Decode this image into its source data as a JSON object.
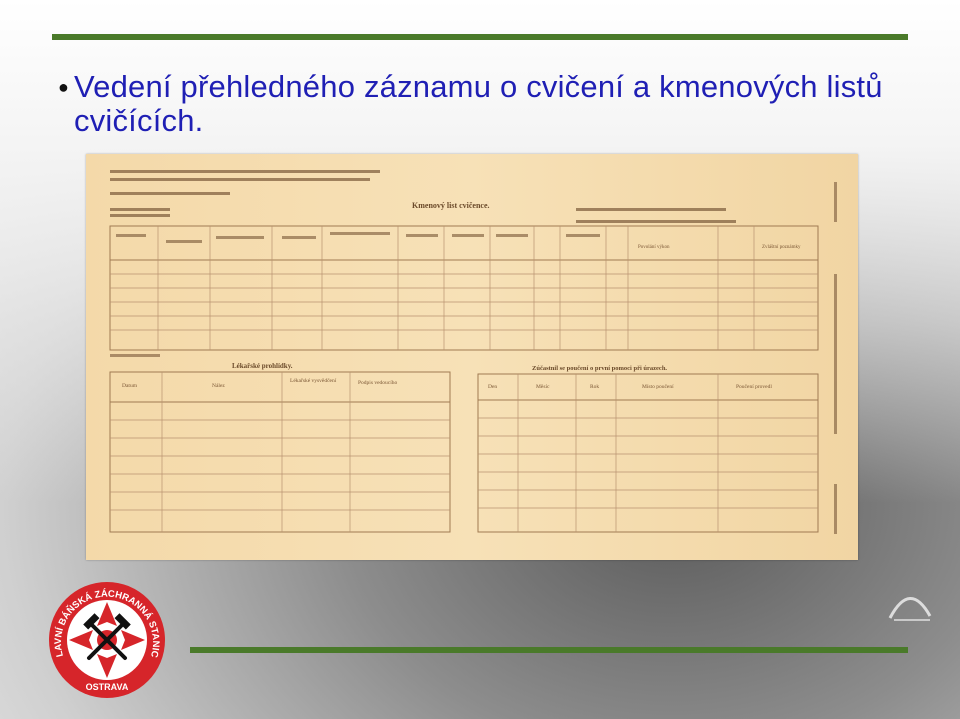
{
  "slide": {
    "title_line1": "Vedení přehledného záznamu o cvičení a  kmenových listů",
    "title_line2": "cvičících.",
    "colors": {
      "title": "#1f1fb4",
      "bars": "#4a7a2a",
      "logo_red": "#d6252a"
    }
  },
  "document_image": {
    "form_title": "Kmenový list cvičence.",
    "section_medical": "Lékařské prohlídky.",
    "section_first_aid": "Zúčastnil se poučení o první pomoci při úrazech.",
    "col_date": "Datum",
    "col_finding": "Nález",
    "col_doctor": "Lékařské vysvědčení",
    "col_signature": "Podpis vedoucího",
    "col_day": "Den",
    "col_month": "Měsíc",
    "col_year": "Rok",
    "col_place": "Místo poučení",
    "col_instructor": "Poučení provedl",
    "col_duty": "Povolání výkon",
    "col_special": "Zvláštní poznámky"
  },
  "logo": {
    "arc_text": "HLAVNÍ BÁŇSKÁ ZÁCHRANNÁ STANICE",
    "city": "OSTRAVA",
    "icon": "mining-rescue-cross-emblem"
  }
}
